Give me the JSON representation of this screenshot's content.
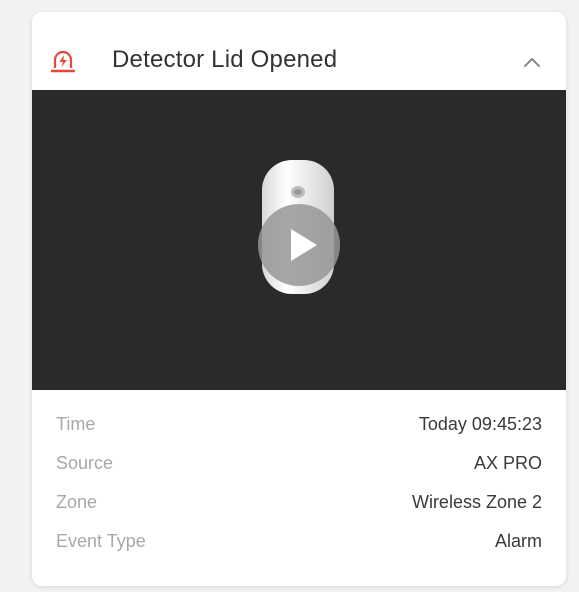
{
  "event": {
    "title": "Detector Lid Opened",
    "icon": "alarm-light-icon",
    "collapse_icon": "chevron-up-icon",
    "accent_color": "#e5483f"
  },
  "video": {
    "play_icon": "play-icon",
    "background_color": "#2a2a2a"
  },
  "details": [
    {
      "label": "Time",
      "value": "Today 09:45:23"
    },
    {
      "label": "Source",
      "value": "AX PRO"
    },
    {
      "label": "Zone",
      "value": "Wireless Zone 2"
    },
    {
      "label": "Event Type",
      "value": "Alarm"
    }
  ]
}
